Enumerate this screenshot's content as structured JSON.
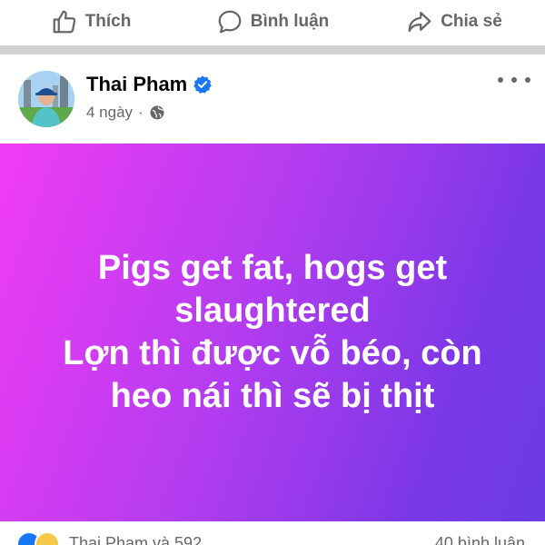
{
  "actions": {
    "like": "Thích",
    "comment": "Bình luận",
    "share": "Chia sẻ"
  },
  "post": {
    "author": "Thai Pham",
    "time": "4 ngày",
    "lines": [
      "Pigs get fat, hogs get",
      "slaughtered",
      "Lợn thì được vỗ béo, còn",
      "heo nái thì sẽ bị thịt"
    ],
    "reactions": "Thai Pham và 592",
    "comments": "40 bình luận"
  },
  "colors": {
    "gradient_start": "#f13cf4",
    "gradient_end": "#6a3be4",
    "verified": "#1877f2",
    "muted_text": "#65676b"
  }
}
